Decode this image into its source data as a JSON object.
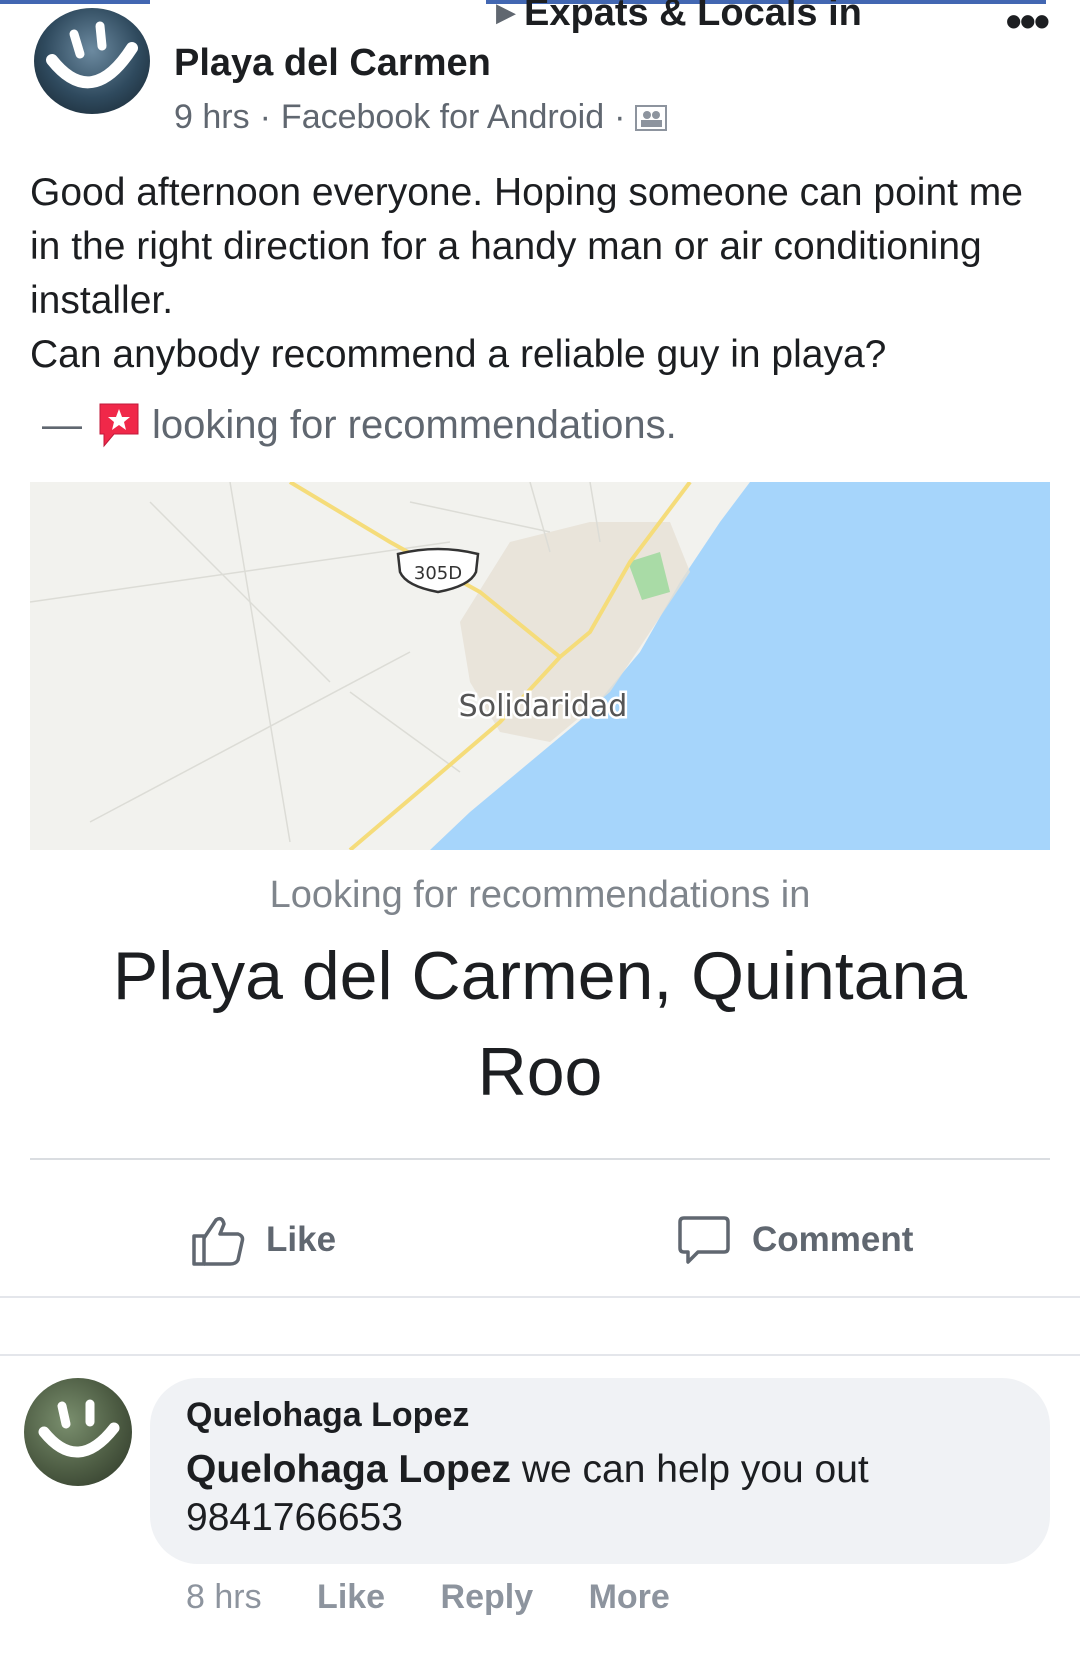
{
  "post": {
    "group_name": "Expats & Locals in",
    "author": "Playa del Carmen",
    "time": "9 hrs",
    "via": "Facebook for Android",
    "audience_icon": "group-audience-icon",
    "text": "Good afternoon everyone. Hoping someone can point me in the right direction for a handy man or air conditioning installer.\nCan anybody recommend a reliable guy in playa?",
    "activity_dash": "—",
    "activity": "looking for recommendations."
  },
  "map": {
    "shield_label": "305D",
    "city_label": "Solidaridad",
    "colors": {
      "land": "#f2f2ee",
      "water": "#a6d5fb",
      "road": "#f5dc7a",
      "park": "#a9dba6"
    }
  },
  "recommendation": {
    "caption": "Looking for recommendations in",
    "place": "Playa del Carmen, Quintana Roo"
  },
  "actions": {
    "like": "Like",
    "comment": "Comment"
  },
  "comment": {
    "author": "Quelohaga Lopez",
    "tagged_name": "Quelohaga Lopez",
    "text": " we can help you out 9841766653",
    "time": "8 hrs",
    "like": "Like",
    "reply": "Reply",
    "more": "More"
  },
  "colors": {
    "accent": "#4267b2",
    "secondary_text": "#606770",
    "bubble": "#f0f2f5"
  }
}
